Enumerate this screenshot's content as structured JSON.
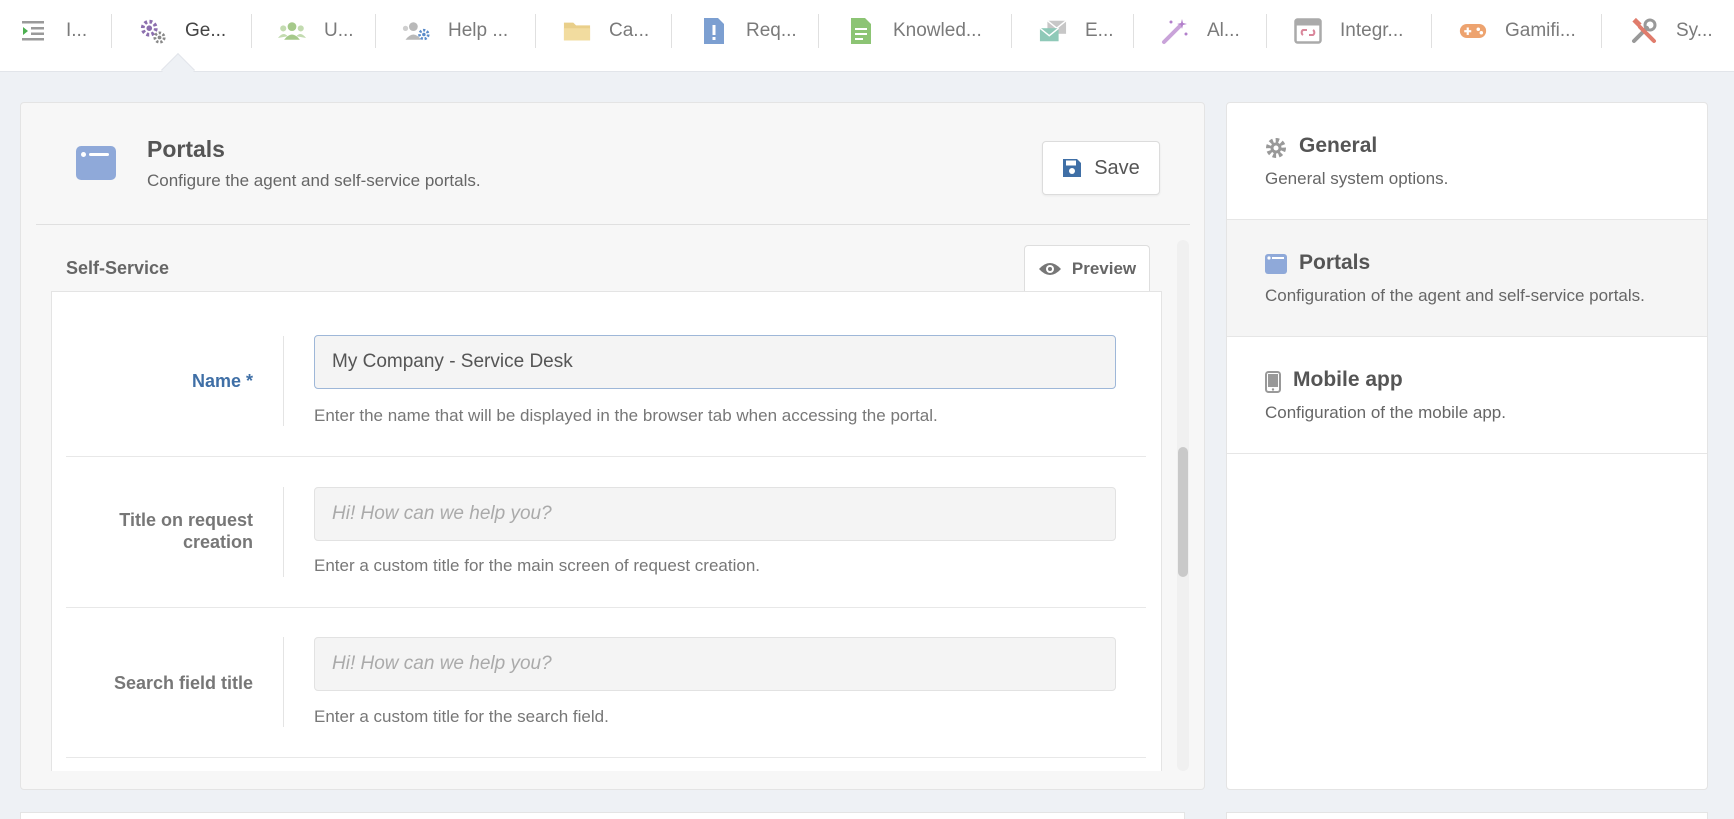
{
  "nav": {
    "items": [
      {
        "label": "I...",
        "icon": "list-indent-icon"
      },
      {
        "label": "Ge...",
        "icon": "gears-icon",
        "active": true
      },
      {
        "label": "U...",
        "icon": "users-icon"
      },
      {
        "label": "Help ...",
        "icon": "users-gear-icon"
      },
      {
        "label": "Ca...",
        "icon": "folder-icon"
      },
      {
        "label": "Req...",
        "icon": "file-exclamation-icon"
      },
      {
        "label": "Knowled...",
        "icon": "file-text-icon"
      },
      {
        "label": "E...",
        "icon": "envelopes-icon"
      },
      {
        "label": "Al...",
        "icon": "magic-wand-icon"
      },
      {
        "label": "Integr...",
        "icon": "browser-link-icon"
      },
      {
        "label": "Gamifi...",
        "icon": "gamepad-icon"
      },
      {
        "label": "Sy...",
        "icon": "tools-icon"
      }
    ]
  },
  "header": {
    "title": "Portals",
    "subtitle": "Configure the agent and self-service portals.",
    "save_label": "Save"
  },
  "section": {
    "title": "Self-Service",
    "preview_label": "Preview"
  },
  "form": {
    "name": {
      "label": "Name *",
      "value": "My Company - Service Desk",
      "help": "Enter the name that will be displayed in the browser tab when accessing the portal."
    },
    "request_title": {
      "label": "Title on request creation",
      "placeholder": "Hi! How can we help you?",
      "help": "Enter a custom title for the main screen of request creation."
    },
    "search_title": {
      "label": "Search field title",
      "placeholder": "Hi! How can we help you?",
      "help": "Enter a custom title for the search field."
    }
  },
  "side": {
    "items": [
      {
        "title": "General",
        "desc": "General system options.",
        "icon": "gear-icon"
      },
      {
        "title": "Portals",
        "desc": "Configuration of the agent and self-service portals.",
        "icon": "browser-window-icon",
        "active": true
      },
      {
        "title": "Mobile app",
        "desc": "Configuration of the mobile app.",
        "icon": "mobile-icon"
      }
    ]
  },
  "colors": {
    "accent": "#3f6fa6",
    "portal_icon": "#8fa9d9",
    "page_bg": "#eef1f5"
  }
}
